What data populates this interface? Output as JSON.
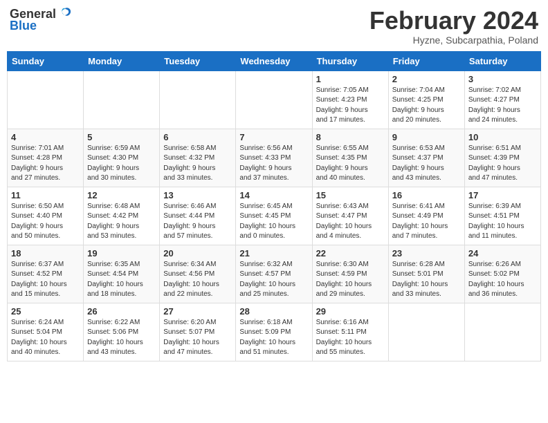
{
  "header": {
    "logo_general": "General",
    "logo_blue": "Blue",
    "title": "February 2024",
    "location": "Hyzne, Subcarpathia, Poland"
  },
  "days_of_week": [
    "Sunday",
    "Monday",
    "Tuesday",
    "Wednesday",
    "Thursday",
    "Friday",
    "Saturday"
  ],
  "weeks": [
    [
      {
        "day": "",
        "info": ""
      },
      {
        "day": "",
        "info": ""
      },
      {
        "day": "",
        "info": ""
      },
      {
        "day": "",
        "info": ""
      },
      {
        "day": "1",
        "info": "Sunrise: 7:05 AM\nSunset: 4:23 PM\nDaylight: 9 hours\nand 17 minutes."
      },
      {
        "day": "2",
        "info": "Sunrise: 7:04 AM\nSunset: 4:25 PM\nDaylight: 9 hours\nand 20 minutes."
      },
      {
        "day": "3",
        "info": "Sunrise: 7:02 AM\nSunset: 4:27 PM\nDaylight: 9 hours\nand 24 minutes."
      }
    ],
    [
      {
        "day": "4",
        "info": "Sunrise: 7:01 AM\nSunset: 4:28 PM\nDaylight: 9 hours\nand 27 minutes."
      },
      {
        "day": "5",
        "info": "Sunrise: 6:59 AM\nSunset: 4:30 PM\nDaylight: 9 hours\nand 30 minutes."
      },
      {
        "day": "6",
        "info": "Sunrise: 6:58 AM\nSunset: 4:32 PM\nDaylight: 9 hours\nand 33 minutes."
      },
      {
        "day": "7",
        "info": "Sunrise: 6:56 AM\nSunset: 4:33 PM\nDaylight: 9 hours\nand 37 minutes."
      },
      {
        "day": "8",
        "info": "Sunrise: 6:55 AM\nSunset: 4:35 PM\nDaylight: 9 hours\nand 40 minutes."
      },
      {
        "day": "9",
        "info": "Sunrise: 6:53 AM\nSunset: 4:37 PM\nDaylight: 9 hours\nand 43 minutes."
      },
      {
        "day": "10",
        "info": "Sunrise: 6:51 AM\nSunset: 4:39 PM\nDaylight: 9 hours\nand 47 minutes."
      }
    ],
    [
      {
        "day": "11",
        "info": "Sunrise: 6:50 AM\nSunset: 4:40 PM\nDaylight: 9 hours\nand 50 minutes."
      },
      {
        "day": "12",
        "info": "Sunrise: 6:48 AM\nSunset: 4:42 PM\nDaylight: 9 hours\nand 53 minutes."
      },
      {
        "day": "13",
        "info": "Sunrise: 6:46 AM\nSunset: 4:44 PM\nDaylight: 9 hours\nand 57 minutes."
      },
      {
        "day": "14",
        "info": "Sunrise: 6:45 AM\nSunset: 4:45 PM\nDaylight: 10 hours\nand 0 minutes."
      },
      {
        "day": "15",
        "info": "Sunrise: 6:43 AM\nSunset: 4:47 PM\nDaylight: 10 hours\nand 4 minutes."
      },
      {
        "day": "16",
        "info": "Sunrise: 6:41 AM\nSunset: 4:49 PM\nDaylight: 10 hours\nand 7 minutes."
      },
      {
        "day": "17",
        "info": "Sunrise: 6:39 AM\nSunset: 4:51 PM\nDaylight: 10 hours\nand 11 minutes."
      }
    ],
    [
      {
        "day": "18",
        "info": "Sunrise: 6:37 AM\nSunset: 4:52 PM\nDaylight: 10 hours\nand 15 minutes."
      },
      {
        "day": "19",
        "info": "Sunrise: 6:35 AM\nSunset: 4:54 PM\nDaylight: 10 hours\nand 18 minutes."
      },
      {
        "day": "20",
        "info": "Sunrise: 6:34 AM\nSunset: 4:56 PM\nDaylight: 10 hours\nand 22 minutes."
      },
      {
        "day": "21",
        "info": "Sunrise: 6:32 AM\nSunset: 4:57 PM\nDaylight: 10 hours\nand 25 minutes."
      },
      {
        "day": "22",
        "info": "Sunrise: 6:30 AM\nSunset: 4:59 PM\nDaylight: 10 hours\nand 29 minutes."
      },
      {
        "day": "23",
        "info": "Sunrise: 6:28 AM\nSunset: 5:01 PM\nDaylight: 10 hours\nand 33 minutes."
      },
      {
        "day": "24",
        "info": "Sunrise: 6:26 AM\nSunset: 5:02 PM\nDaylight: 10 hours\nand 36 minutes."
      }
    ],
    [
      {
        "day": "25",
        "info": "Sunrise: 6:24 AM\nSunset: 5:04 PM\nDaylight: 10 hours\nand 40 minutes."
      },
      {
        "day": "26",
        "info": "Sunrise: 6:22 AM\nSunset: 5:06 PM\nDaylight: 10 hours\nand 43 minutes."
      },
      {
        "day": "27",
        "info": "Sunrise: 6:20 AM\nSunset: 5:07 PM\nDaylight: 10 hours\nand 47 minutes."
      },
      {
        "day": "28",
        "info": "Sunrise: 6:18 AM\nSunset: 5:09 PM\nDaylight: 10 hours\nand 51 minutes."
      },
      {
        "day": "29",
        "info": "Sunrise: 6:16 AM\nSunset: 5:11 PM\nDaylight: 10 hours\nand 55 minutes."
      },
      {
        "day": "",
        "info": ""
      },
      {
        "day": "",
        "info": ""
      }
    ]
  ]
}
